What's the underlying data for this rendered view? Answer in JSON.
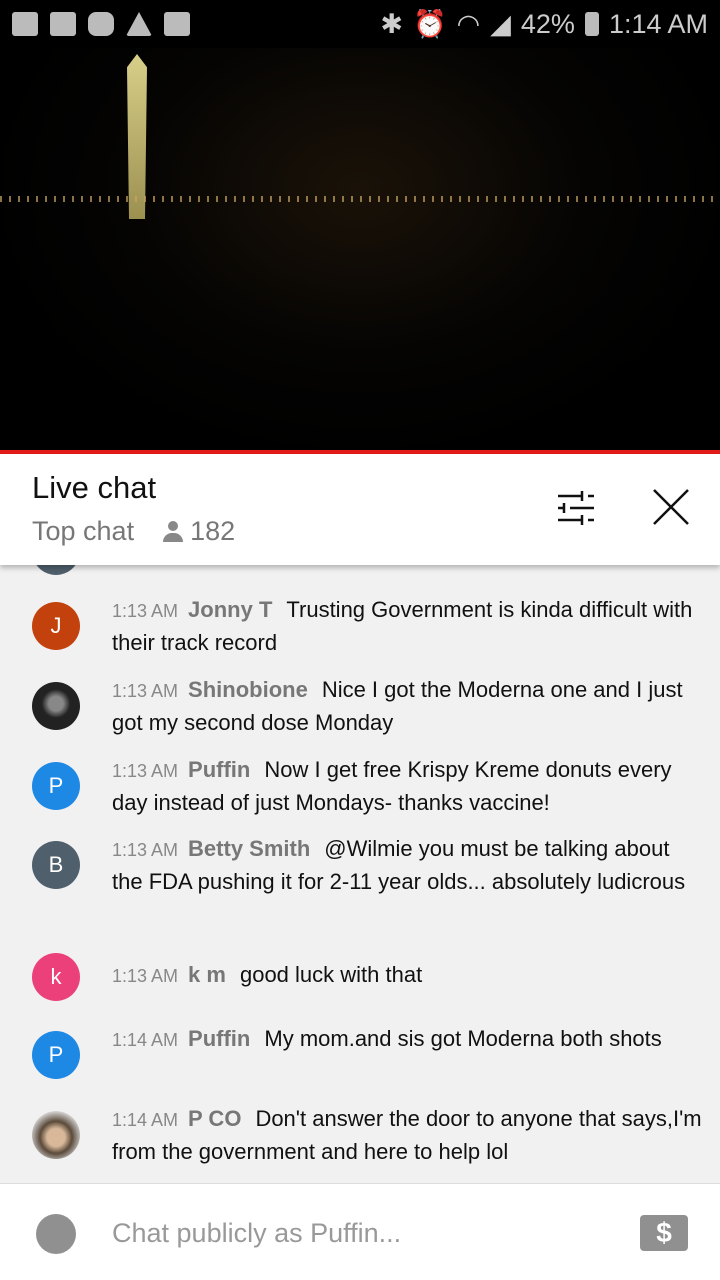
{
  "status_bar": {
    "battery": "42%",
    "time": "1:14 AM"
  },
  "header": {
    "title": "Live chat",
    "mode": "Top chat",
    "viewers": "182"
  },
  "messages": [
    {
      "time": "1:13 AM",
      "author": "Jonny T",
      "text": "Trusting Government is kinda difficult with their track record",
      "avatar_letter": "J",
      "avatar_color": "#c2410c"
    },
    {
      "time": "1:13 AM",
      "author": "Shinobione",
      "text": "Nice I got the Moderna one and I just got my second dose Monday",
      "avatar_letter": "",
      "avatar_color": "#222222"
    },
    {
      "time": "1:13 AM",
      "author": "Puffin",
      "text": "Now I get free Krispy Kreme donuts every day instead of just Mondays- thanks vaccine!",
      "avatar_letter": "P",
      "avatar_color": "#1e88e5"
    },
    {
      "time": "1:13 AM",
      "author": "Betty Smith",
      "text": "@Wilmie you must be talking about the FDA pushing it for 2-11 year olds... absolutely ludicrous",
      "avatar_letter": "B",
      "avatar_color": "#4f5f6b"
    },
    {
      "time": "1:13 AM",
      "author": "k m",
      "text": "good luck with that",
      "avatar_letter": "k",
      "avatar_color": "#ec407a"
    },
    {
      "time": "1:14 AM",
      "author": "Puffin",
      "text": "My mom.and sis got Moderna both shots",
      "avatar_letter": "P",
      "avatar_color": "#1e88e5"
    },
    {
      "time": "1:14 AM",
      "author": "P CO",
      "text": "Don't answer the door to anyone that says,I'm from the government and here to help lol",
      "avatar_letter": "",
      "avatar_color": "#6b5a48"
    }
  ],
  "input": {
    "placeholder": "Chat publicly as Puffin...",
    "money_symbol": "$"
  }
}
